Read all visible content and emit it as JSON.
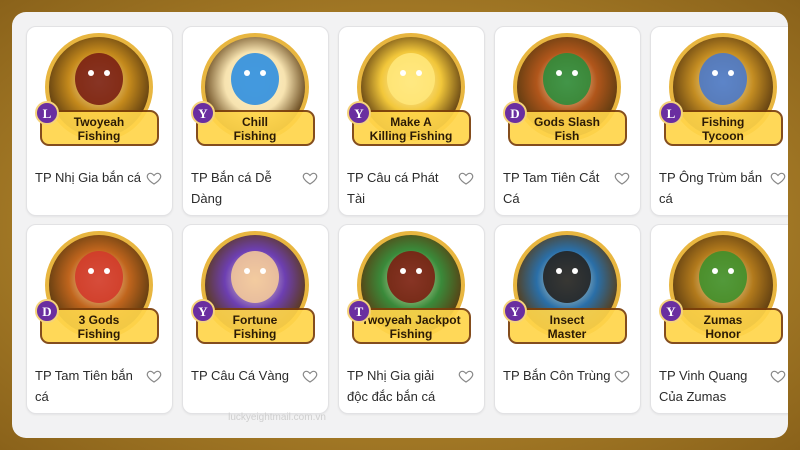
{
  "games": [
    {
      "title": "TP Nhị Gia bắn cá",
      "badge": "L",
      "badge_color": "#6a2ea0",
      "logo": "Twoyeah Fishing",
      "bg": "#c58a1c",
      "figure": "#7a1f12"
    },
    {
      "title": "TP Bắn cá Dễ Dàng",
      "badge": "Y",
      "badge_color": "#6a2ea0",
      "logo": "Chill Fishing",
      "bg": "#f7e3b0",
      "figure": "#2f8fe0"
    },
    {
      "title": "TP Câu cá Phát Tài",
      "badge": "Y",
      "badge_color": "#6a2ea0",
      "logo": "Make A Killing Fishing",
      "bg": "#f2c73a",
      "figure": "#ffe779"
    },
    {
      "title": "TP Tam Tiên Cắt Cá",
      "badge": "D",
      "badge_color": "#6a2ea0",
      "logo": "Gods Slash Fish",
      "bg": "#b1561b",
      "figure": "#2e8b3a"
    },
    {
      "title": "TP Ông Trùm bắn cá",
      "badge": "L",
      "badge_color": "#6a2ea0",
      "logo": "Fishing Tycoon",
      "bg": "#c48d22",
      "figure": "#4a78c8"
    },
    {
      "title": "TP Tam Tiên bắn cá",
      "badge": "D",
      "badge_color": "#6a2ea0",
      "logo": "3 Gods Fishing",
      "bg": "#c0651d",
      "figure": "#d13a2a"
    },
    {
      "title": "TP Câu Cá Vàng",
      "badge": "Y",
      "badge_color": "#6a2ea0",
      "logo": "Fortune Fishing",
      "bg": "#6d3fb2",
      "figure": "#f2c79a"
    },
    {
      "title": "TP Nhị Gia giải độc đắc bắn cá",
      "badge": "T",
      "badge_color": "#6a2ea0",
      "logo": "Twoyeah Jackpot Fishing",
      "bg": "#3a8a3a",
      "figure": "#7a1f12"
    },
    {
      "title": "TP Bắn Côn Trùng",
      "badge": "Y",
      "badge_color": "#6a2ea0",
      "logo": "Insect Master",
      "bg": "#2a6fa8",
      "figure": "#222222"
    },
    {
      "title": "TP Vinh Quang Của Zumas",
      "badge": "Y",
      "badge_color": "#6a2ea0",
      "logo": "Zumas Honor",
      "bg": "#b27a1c",
      "figure": "#3f8f2a"
    }
  ],
  "watermark": "luckyeightmail.com.vn"
}
